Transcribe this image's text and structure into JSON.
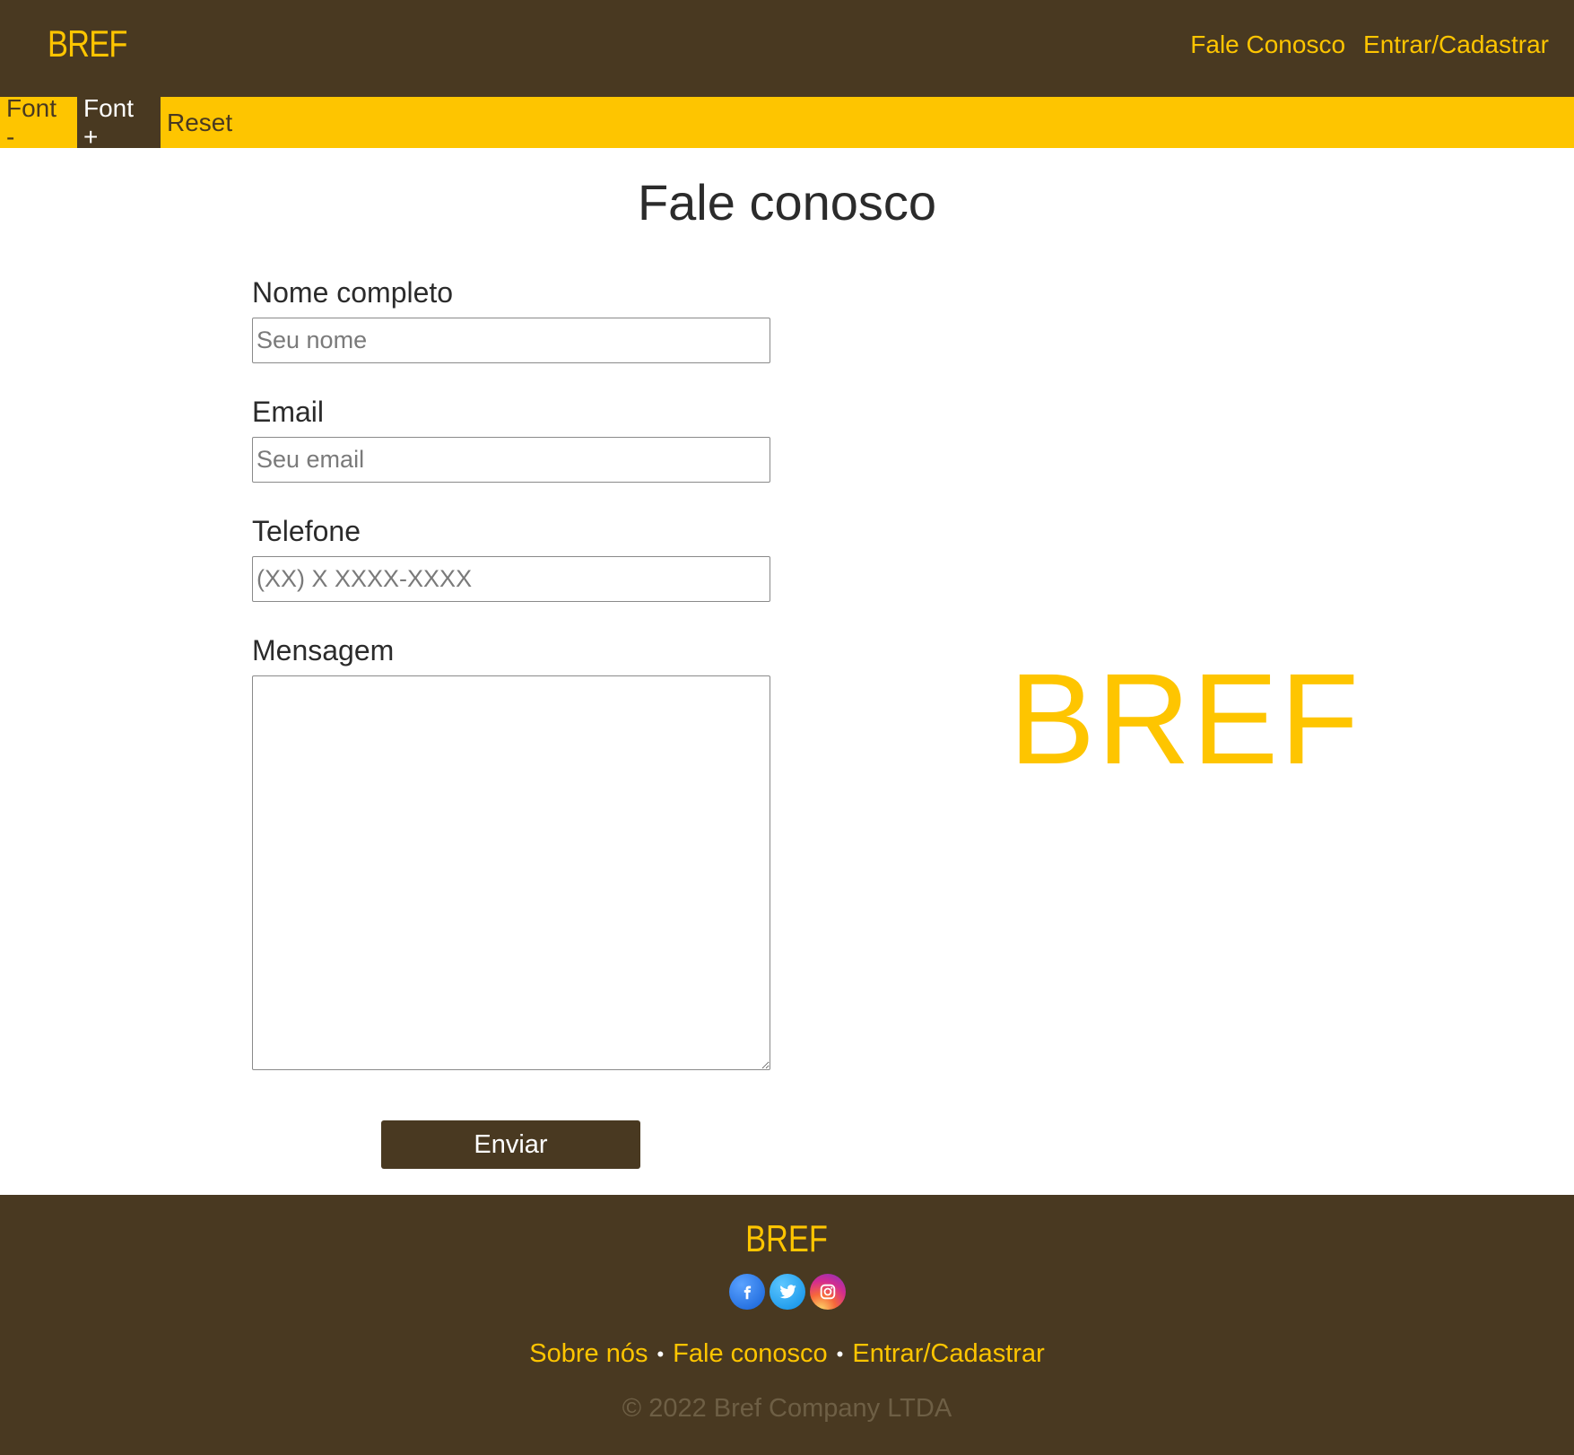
{
  "header": {
    "logo": "BREF",
    "nav": {
      "contact": "Fale Conosco",
      "login": "Entrar/Cadastrar"
    }
  },
  "accessibility": {
    "font_decrease": "Font -",
    "font_increase": "Font +",
    "reset": "Reset"
  },
  "main": {
    "title": "Fale conosco",
    "form": {
      "name": {
        "label": "Nome completo",
        "placeholder": "Seu nome",
        "value": ""
      },
      "email": {
        "label": "Email",
        "placeholder": "Seu email",
        "value": ""
      },
      "phone": {
        "label": "Telefone",
        "placeholder": "(XX) X XXXX-XXXX",
        "value": ""
      },
      "message": {
        "label": "Mensagem",
        "value": ""
      },
      "submit": "Enviar"
    },
    "brand_mark": "BREF"
  },
  "footer": {
    "logo": "BREF",
    "social": [
      "facebook-icon",
      "twitter-icon",
      "instagram-icon"
    ],
    "links": {
      "about": "Sobre nós",
      "contact": "Fale conosco",
      "login": "Entrar/Cadastrar",
      "separator": "•"
    },
    "copyright": "© 2022 Bref Company LTDA"
  },
  "colors": {
    "brown": "#493921",
    "yellow": "#fec500",
    "text": "#2b2b2b",
    "copyright": "#6e5f45"
  }
}
